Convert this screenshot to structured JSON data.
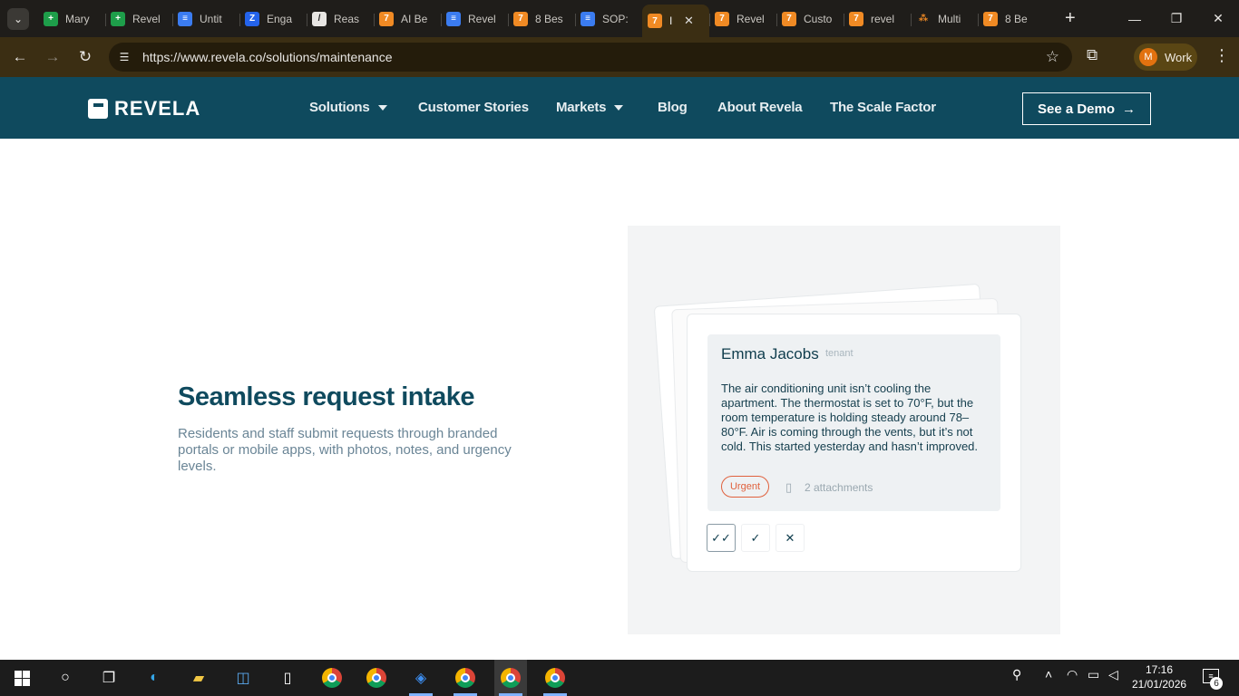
{
  "browser": {
    "tabs": [
      {
        "title": "Mary",
        "icon": "sheets-icon",
        "active": false
      },
      {
        "title": "Revel",
        "icon": "sheets-icon",
        "active": false
      },
      {
        "title": "Untit",
        "icon": "docs-icon",
        "active": false
      },
      {
        "title": "Enga",
        "icon": "engage-icon",
        "active": false
      },
      {
        "title": "Reas",
        "icon": "reason-icon",
        "active": false
      },
      {
        "title": "AI Be",
        "icon": "revela-icon",
        "active": false
      },
      {
        "title": "Revel",
        "icon": "docs-icon",
        "active": false
      },
      {
        "title": "8 Bes",
        "icon": "revela-icon",
        "active": false
      },
      {
        "title": "SOP:",
        "icon": "docs-icon",
        "active": false
      },
      {
        "title": "I",
        "icon": "revela-icon",
        "active": true
      },
      {
        "title": "Revel",
        "icon": "revela-icon",
        "active": false
      },
      {
        "title": "Custo",
        "icon": "revela-icon",
        "active": false
      },
      {
        "title": "revel",
        "icon": "revela-icon",
        "active": false
      },
      {
        "title": "Multi",
        "icon": "multi-icon",
        "active": false
      },
      {
        "title": "8 Be",
        "icon": "revela-icon",
        "active": false
      }
    ],
    "url": "https://www.revela.co/solutions/maintenance",
    "profile_initial": "M",
    "profile_label": "Work"
  },
  "site": {
    "logo_text": "REVELA",
    "nav": {
      "solutions": "Solutions",
      "customer_stories": "Customer Stories",
      "markets": "Markets",
      "blog": "Blog",
      "about": "About Revela",
      "scale_factor": "The Scale Factor"
    },
    "cta": "See a Demo",
    "cta_arrow": "→"
  },
  "section": {
    "title": "Seamless request intake",
    "description": "Residents and staff submit requests through branded portals or mobile apps, with photos, notes, and urgency levels."
  },
  "request_card": {
    "name": "Emma Jacobs",
    "role": "tenant",
    "message": "The air conditioning unit isn’t cooling the apartment. The thermostat is set to 70°F, but the room temperature is holding steady around 78–80°F. Air is coming through the vents, but it’s not cold. This started yesterday and hasn’t improved.",
    "urgency": "Urgent",
    "attachments": "2 attachments"
  },
  "taskbar": {
    "time": "17:16",
    "date": "21/01/2026",
    "notification_count": "6"
  },
  "colors": {
    "brand": "#0f4a5e",
    "urgent": "#e0613d",
    "panel": "#f3f4f5",
    "browser_frame": "#3b2e13"
  }
}
